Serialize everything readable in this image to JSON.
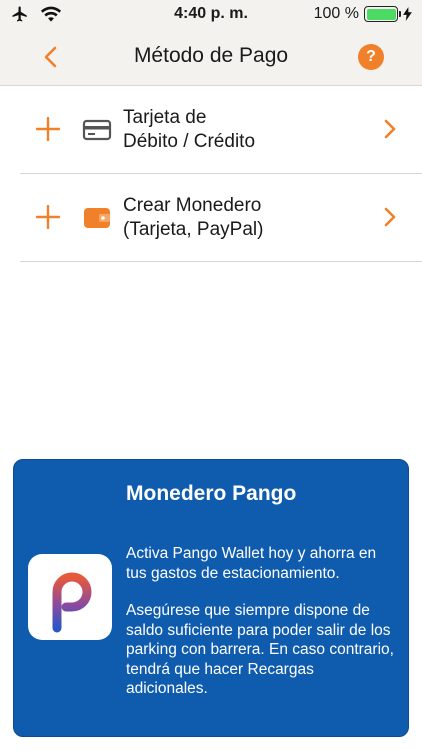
{
  "status_bar": {
    "time": "4:40 p. m.",
    "battery_percent": "100 %",
    "battery_level": 1.0,
    "icons": [
      "airplane-icon",
      "wifi-icon",
      "battery-icon",
      "charging-icon"
    ]
  },
  "nav": {
    "title": "Método de Pago",
    "help_label": "?",
    "icons": [
      "back-chevron-icon",
      "help-icon"
    ]
  },
  "payment_options": [
    {
      "line1": "Tarjeta de",
      "line2": "Débito / Crédito",
      "icon": "credit-card-icon"
    },
    {
      "line1": "Crear Monedero",
      "line2": "(Tarjeta, PayPal)",
      "icon": "wallet-icon"
    }
  ],
  "promo": {
    "title": "Monedero Pango",
    "paragraph1": "Activa Pango Wallet hoy y ahorra en tus gastos de estacionamiento.",
    "paragraph2": "Asegúrese que siempre dispone de saldo suficiente para poder salir de los parking con barrera. En caso contrario, tendrá que hacer Recargas adicionales.",
    "logo_icon": "pango-logo-icon"
  },
  "colors": {
    "accent": "#f0812a",
    "card_blue": "#0f5cae",
    "bar_bg": "#f4f2ef",
    "battery_green": "#4cd964"
  }
}
